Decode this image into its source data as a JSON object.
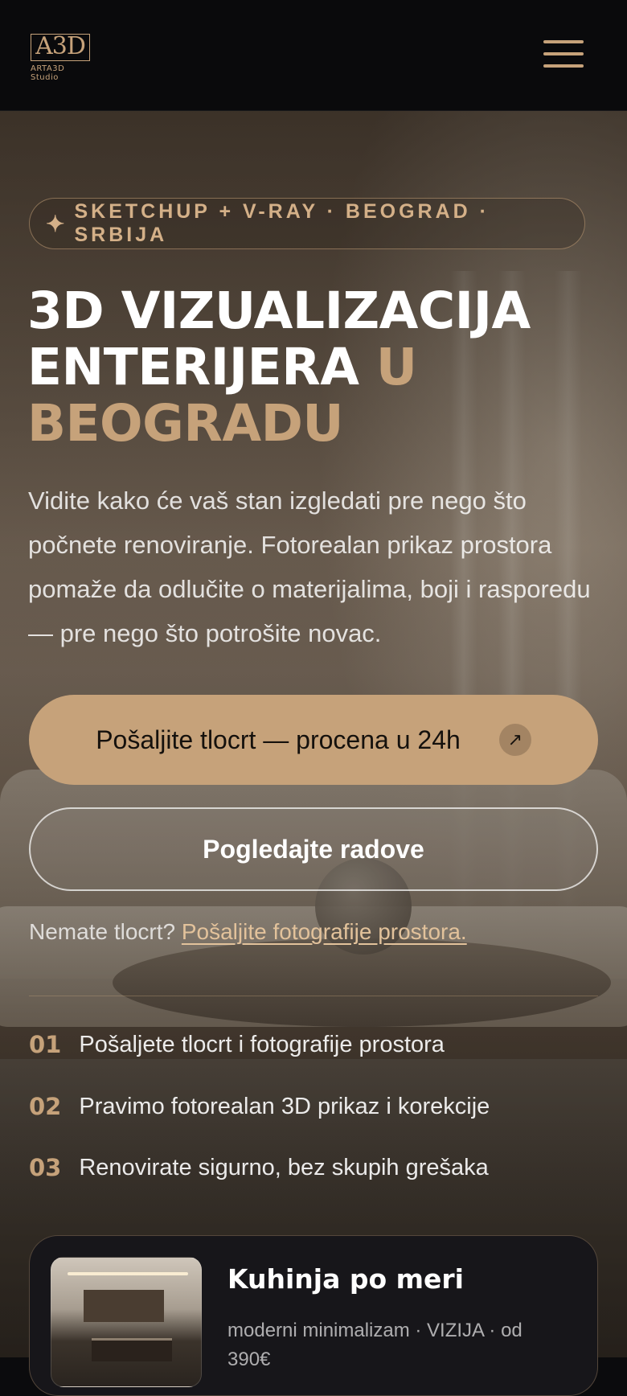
{
  "header": {
    "logo_mark": "A3D",
    "logo_subtitle": "ARTA3D Studio"
  },
  "hero": {
    "badge": "SKETCHUP + V-RAY · BEOGRAD · SRBIJA",
    "title_line1": "3D VIZUALIZACIJA",
    "title_line2": "ENTERIJERA ",
    "title_accent_inline": "U",
    "title_accent_line": "BEOGRADU",
    "description": "Vidite kako će vaš stan izgledati pre nego što počnete renoviranje. Fotorealan prikaz prostora pomaže da odlučite o materijalima, boji i rasporedu — pre nego što potrošite novac.",
    "cta_primary_label": "Pošaljite tlocrt — procena u 24h",
    "cta_primary_arrow": "↗",
    "cta_secondary_label": "Pogledajte radove",
    "no_plan_text": "Nemate tlocrt? ",
    "no_plan_link": "Pošaljite fotografije prostora."
  },
  "steps": [
    {
      "num": "01",
      "text": "Pošaljete tlocrt i fotografije prostora"
    },
    {
      "num": "02",
      "text": "Pravimo fotorealan 3D prikaz i korekcije"
    },
    {
      "num": "03",
      "text": "Renovirate sigurno, bez skupih grešaka"
    }
  ],
  "project_card": {
    "title": "Kuhinja po meri",
    "meta": "moderni minimalizam · VIZIJA · od 390€"
  },
  "colors": {
    "accent": "#c6a27a",
    "header_bg": "#0a0a0c",
    "card_bg": "#17161a"
  },
  "icons": {
    "badge_icon": "sparkle-icon",
    "menu": "hamburger-menu-icon",
    "cta_arrow": "arrow-up-right-icon"
  }
}
